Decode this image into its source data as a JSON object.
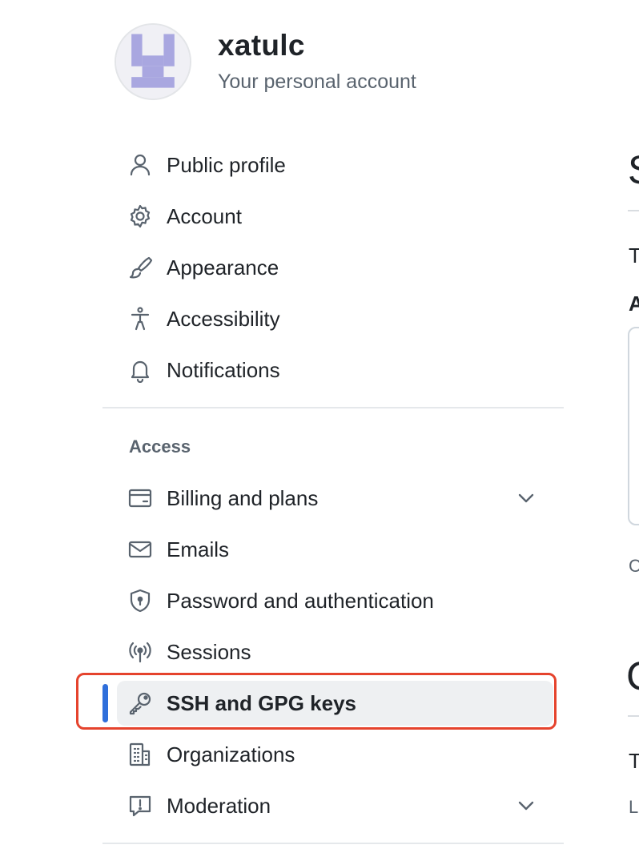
{
  "header": {
    "username": "xatulc",
    "subtitle": "Your personal account"
  },
  "nav": {
    "items": [
      {
        "label": "Public profile",
        "icon": "person-icon"
      },
      {
        "label": "Account",
        "icon": "gear-icon"
      },
      {
        "label": "Appearance",
        "icon": "paintbrush-icon"
      },
      {
        "label": "Accessibility",
        "icon": "accessibility-icon"
      },
      {
        "label": "Notifications",
        "icon": "bell-icon"
      }
    ],
    "access_heading": "Access",
    "access_items": [
      {
        "label": "Billing and plans",
        "icon": "credit-card-icon",
        "expandable": true
      },
      {
        "label": "Emails",
        "icon": "mail-icon"
      },
      {
        "label": "Password and authentication",
        "icon": "shield-lock-icon"
      },
      {
        "label": "Sessions",
        "icon": "broadcast-icon"
      },
      {
        "label": "SSH and GPG keys",
        "icon": "key-icon",
        "active": true
      },
      {
        "label": "Organizations",
        "icon": "organization-icon"
      },
      {
        "label": "Moderation",
        "icon": "report-icon",
        "expandable": true
      }
    ]
  },
  "right_panel": {
    "fragments": [
      "S",
      "T",
      "A",
      "C",
      "C",
      "T",
      "L"
    ]
  },
  "colors": {
    "active_bar": "#2f6fdb",
    "highlight_border": "#e5432d",
    "active_bg": "#eef0f2",
    "muted_text": "#59636e"
  }
}
